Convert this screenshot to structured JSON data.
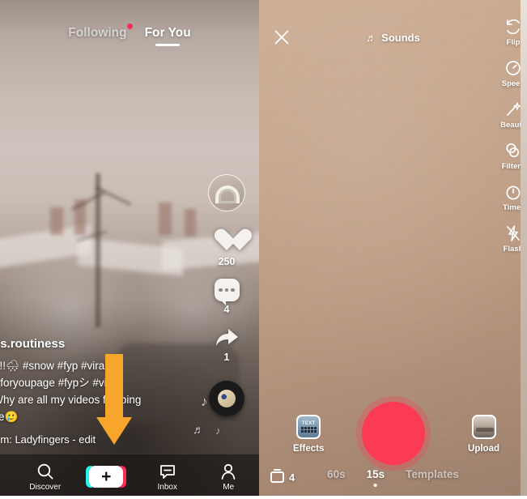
{
  "feed": {
    "tabs": [
      {
        "label": "Following",
        "active": false,
        "has_dot": true
      },
      {
        "label": "For You",
        "active": true,
        "has_dot": false
      }
    ],
    "author": "ences.routiness",
    "caption_lines": [
      " day!!!🌨 #snow #fyp #viral",
      "ou #foryoupage #fypシ #viral",
      "vy Why are all my videos flopping",
      "e like🥲"
    ],
    "music_line": ": from: Ladyfingers - edit",
    "actions": {
      "avatar_name": "profile-avatar",
      "like_count": "250",
      "comment_count": "4",
      "share_count": "1"
    },
    "nav": [
      {
        "label": "Discover",
        "icon": "search-icon"
      },
      {
        "label": "",
        "icon": "plus-create-icon"
      },
      {
        "label": "Inbox",
        "icon": "inbox-icon"
      },
      {
        "label": "Me",
        "icon": "profile-icon"
      }
    ],
    "plus_glyph": "+"
  },
  "annotation": {
    "arrow_color": "#f7a62b",
    "points_to": "plus-create-button"
  },
  "camera": {
    "close_label": "✕",
    "sounds_label": "Sounds",
    "sounds_icon": "music-note-icon",
    "tools": [
      {
        "label": "Flip",
        "icon": "flip-camera-icon"
      },
      {
        "label": "Speed",
        "icon": "speed-icon"
      },
      {
        "label": "Beauty",
        "icon": "beauty-wand-icon"
      },
      {
        "label": "Filters",
        "icon": "filters-icon"
      },
      {
        "label": "Timer",
        "icon": "timer-icon"
      },
      {
        "label": "Flash",
        "icon": "flash-icon"
      }
    ],
    "effects_label": "Effects",
    "effects_tile_text": "TEXT",
    "upload_label": "Upload",
    "frames_count": "4",
    "modes": [
      {
        "label": "60s",
        "active": false
      },
      {
        "label": "15s",
        "active": true
      },
      {
        "label": "Templates",
        "active": false
      }
    ],
    "record_color": "#fb3a54"
  }
}
